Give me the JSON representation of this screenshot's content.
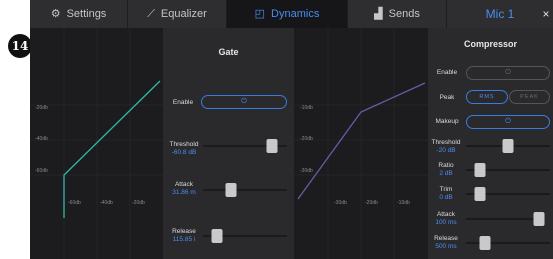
{
  "tabs": [
    {
      "label": "Settings",
      "icon": "gear-icon",
      "glyph": "⚙"
    },
    {
      "label": "Equalizer",
      "icon": "equalizer-icon",
      "glyph": "⟋"
    },
    {
      "label": "Dynamics",
      "icon": "dynamics-icon",
      "glyph": "◰"
    },
    {
      "label": "Sends",
      "icon": "sends-icon",
      "glyph": "▟"
    }
  ],
  "channel": "Mic 1",
  "close_glyph": "×",
  "badge": "14",
  "gate_graph": {
    "y_labels": [
      "-20db",
      "-40db",
      "-60db"
    ],
    "x_labels": [
      "-60db",
      "-40db",
      "-20db"
    ]
  },
  "comp_graph": {
    "y_labels": [
      "-10db",
      "-20db",
      "-30db"
    ],
    "x_labels": [
      "-30db",
      "-20db",
      "-10db"
    ]
  },
  "gate": {
    "title": "Gate",
    "enable_label": "Enable",
    "enable_icon": "power-icon",
    "enable_glyph": "⏻",
    "threshold": {
      "label": "Threshold",
      "value": "-60.8 dB",
      "level": 0.87
    },
    "attack": {
      "label": "Attack",
      "value": "31.86 m",
      "level": 0.31
    },
    "release": {
      "label": "Release",
      "value": "115.85 i",
      "level": 0.11
    }
  },
  "compressor": {
    "title": "Compressor",
    "enable_label": "Enable",
    "enable_icon": "power-icon",
    "enable_glyph": "⏻",
    "peak_label": "Peak",
    "rms_label": "RMS",
    "peak_option_label": "PEAK",
    "makeup_label": "Makeup",
    "makeup_glyph": "⏻",
    "threshold": {
      "label": "Threshold",
      "value": "-20 dB",
      "level": 0.5
    },
    "ratio": {
      "label": "Ratio",
      "value": "2 dB",
      "level": 0.12
    },
    "trim": {
      "label": "Trim",
      "value": "0 dB",
      "level": 0.12
    },
    "attack": {
      "label": "Attack",
      "value": "100 ms",
      "level": 1.0
    },
    "release": {
      "label": "Release",
      "value": "500 ms",
      "level": 0.18
    }
  },
  "colors": {
    "accent": "#4a8ef0",
    "gate_curve": "#2fb9a8",
    "comp_curve": "#6a5aa8"
  }
}
